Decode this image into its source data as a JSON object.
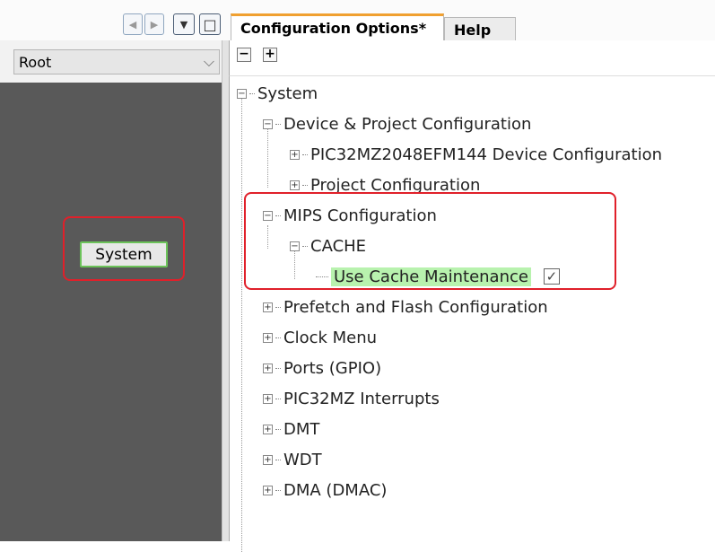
{
  "left_panel": {
    "root_select": "Root",
    "system_button": "System"
  },
  "nav": {
    "prev": "◀",
    "next": "▶",
    "menu": "▼",
    "maximize": "□"
  },
  "tabs": [
    {
      "label": "Configuration Options*"
    },
    {
      "label": "Help"
    }
  ],
  "toolbar": {
    "collapse": "−",
    "expand": "+"
  },
  "tree": [
    {
      "label": "System",
      "level": 0,
      "state": "−"
    },
    {
      "label": "Device & Project Configuration",
      "level": 1,
      "state": "−"
    },
    {
      "label": "PIC32MZ2048EFM144 Device Configuration",
      "level": 2,
      "state": "+"
    },
    {
      "label": "Project Configuration",
      "level": 2,
      "state": "+"
    },
    {
      "label": "MIPS Configuration",
      "level": 1,
      "state": "−"
    },
    {
      "label": "CACHE",
      "level": 2,
      "state": "−"
    },
    {
      "label": "Use Cache Maintenance",
      "level": 3,
      "checked": true,
      "check": "✓"
    },
    {
      "label": "Prefetch and Flash Configuration",
      "level": 1,
      "state": "+"
    },
    {
      "label": "Clock Menu",
      "level": 1,
      "state": "+"
    },
    {
      "label": "Ports (GPIO)",
      "level": 1,
      "state": "+"
    },
    {
      "label": "PIC32MZ Interrupts",
      "level": 1,
      "state": "+"
    },
    {
      "label": "DMT",
      "level": 1,
      "state": "+"
    },
    {
      "label": "WDT",
      "level": 1,
      "state": "+"
    },
    {
      "label": "DMA (DMAC)",
      "level": 1,
      "state": "+"
    }
  ],
  "colors": {
    "highlight": "#b8f2ae",
    "annotation": "#e0202a",
    "tab_accent": "#f0a030"
  }
}
